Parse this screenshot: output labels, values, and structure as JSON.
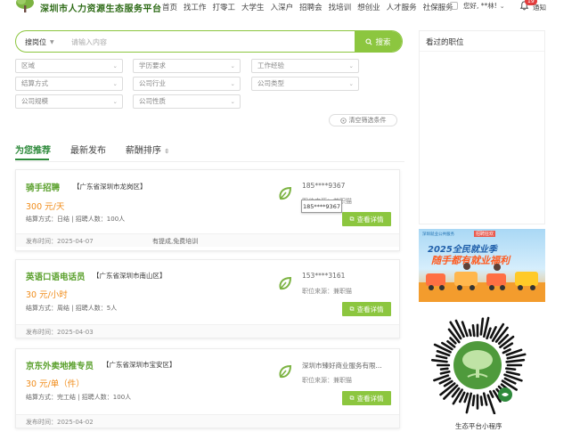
{
  "header": {
    "site_title": "深圳市人力资源生态服务平台",
    "nav": [
      "首页",
      "找工作",
      "打零工",
      "大学生",
      "入深户",
      "招聘会",
      "找培训",
      "想创业",
      "人才服务",
      "社保服务"
    ],
    "user_greeting": "您好, **林!",
    "notification_badge": "19",
    "notification_label": "通知"
  },
  "search": {
    "position_label": "搜岗位",
    "placeholder": "请输入内容",
    "button_label": "搜索"
  },
  "filters": {
    "row1": [
      "区域",
      "学历要求",
      "工作经验"
    ],
    "row2": [
      "结算方式",
      "公司行业",
      "公司类型"
    ],
    "row3": [
      "公司规模",
      "公司性质"
    ],
    "clear_label": "清空筛选条件"
  },
  "tabs": [
    "为您推荐",
    "最新发布",
    "薪酬排序"
  ],
  "jobs": [
    {
      "title": "骑手招聘",
      "location": "【广东省深圳市龙岗区】",
      "salary": "300 元/天",
      "meta": "结算方式：日结 | 招聘人数：100人",
      "contact": "185****9367",
      "source": "职位来源：兼职猫",
      "date": "发布时间：2025-04-07",
      "benefit": "有提成,免费培训",
      "button": "查看详情"
    },
    {
      "title": "英语口语电话员",
      "location": "【广东省深圳市南山区】",
      "salary": "30 元/小时",
      "meta": "结算方式：周结 | 招聘人数：5人",
      "contact": "153****3161",
      "source": "职位来源：兼职猫",
      "date": "发布时间：2025-04-03",
      "benefit": "",
      "button": "查看详情"
    },
    {
      "title": "京东外卖地推专员",
      "location": "【广东省深圳市宝安区】",
      "salary": "30 元/单（件）",
      "meta": "结算方式：完工结 | 招聘人数：100人",
      "contact": "深圳市臻好商业服务有限...",
      "source": "职位来源：兼职猫",
      "date": "发布时间：2025-04-02",
      "benefit": "",
      "button": "查看详情"
    }
  ],
  "tooltip": "185****9367",
  "sidebar": {
    "viewed_title": "看过的职位",
    "banner_brand": "深圳就业公共服务",
    "banner_brand2": "招聘狂欢",
    "banner_line1": "2025全民就业季",
    "banner_line2": "随手都有就业福利",
    "qr_caption": "生态平台小程序"
  },
  "colors": {
    "accent_green": "#8cc63f",
    "title_green": "#5aa02c",
    "salary_orange": "#f08c1a",
    "tab_active": "#2e8a3b"
  }
}
